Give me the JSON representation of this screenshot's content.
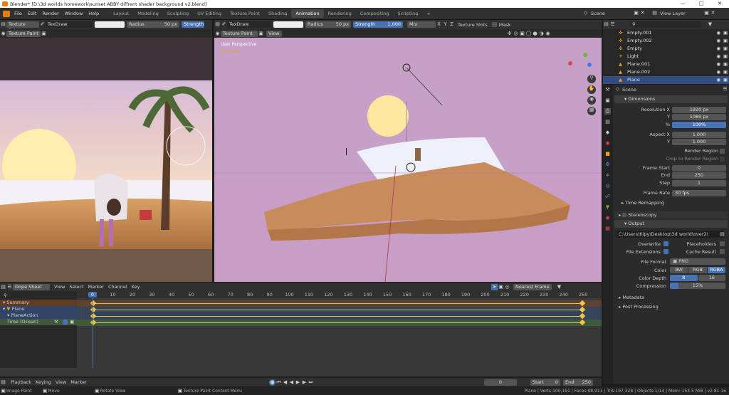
{
  "title": "Blender* [D:\\3d worlds homework\\sunset ABBY diffrent shader background v2.blend]",
  "menus": [
    "File",
    "Edit",
    "Render",
    "Window",
    "Help"
  ],
  "workspaces": [
    "Layout",
    "Modeling",
    "Sculpting",
    "UV Editing",
    "Texture Paint",
    "Shading",
    "Animation",
    "Rendering",
    "Compositing",
    "Scripting"
  ],
  "active_workspace": "Animation",
  "scene_name": "Scene",
  "view_layer": "View Layer",
  "left_view": {
    "mode": "Texture Paint",
    "brush": "TexDraw",
    "radius": "Radius",
    "radius_val": "50 px",
    "strength": "Strength"
  },
  "main_view": {
    "mode": "Texture Paint",
    "view": "View",
    "brush": "TexDraw",
    "radius": "Radius",
    "radius_val": "50 px",
    "strength": "Strength",
    "strength_val": "1.000",
    "blend": "Mix",
    "slots": "Texture Slots",
    "mask": "Mask",
    "persp": "User Perspective",
    "obj": "(0) Plane"
  },
  "outliner": [
    {
      "name": "Empty.001",
      "icon": "empty"
    },
    {
      "name": "Empty.002",
      "icon": "empty"
    },
    {
      "name": "Empty",
      "icon": "empty"
    },
    {
      "name": "Light",
      "icon": "light"
    },
    {
      "name": "Plane.001",
      "icon": "mesh"
    },
    {
      "name": "Plane.002",
      "icon": "mesh"
    },
    {
      "name": "Plane",
      "icon": "mesh"
    }
  ],
  "props": {
    "scene": "Scene",
    "dimensions": "Dimensions",
    "resx_l": "Resolution X",
    "resx": "1920 px",
    "resy_l": "Y",
    "resy": "1080 px",
    "pct_l": "%",
    "pct": "100%",
    "aspx_l": "Aspect X",
    "aspx": "1.000",
    "aspy_l": "Y",
    "aspy": "1.000",
    "render_region": "Render Region",
    "crop": "Crop to Render Region",
    "fstart_l": "Frame Start",
    "fstart": "0",
    "fend_l": "End",
    "fend": "250",
    "step_l": "Step",
    "step": "1",
    "frate_l": "Frame Rate",
    "frate": "30 fps",
    "time_remap": "Time Remapping",
    "stereo": "Stereoscopy",
    "output": "Output",
    "path": "C:\\Users\\Kipy\\Desktop\\3d world\\over2\\",
    "overwrite": "Overwrite",
    "placeholders": "Placeholders",
    "file_ext": "File Extensions",
    "cache": "Cache Result",
    "fformat_l": "File Format",
    "fformat": "PNG",
    "color_l": "Color",
    "bw": "BW",
    "rgb": "RGB",
    "rgba": "RGBA",
    "depth_l": "Color Depth",
    "d8": "8",
    "d16": "16",
    "comp_l": "Compression",
    "comp": "15%",
    "metadata": "Metadata",
    "post": "Post Processing"
  },
  "dope": {
    "mode": "Dope Sheet",
    "menus": [
      "View",
      "Select",
      "Marker",
      "Channel",
      "Key"
    ],
    "snap": "Nearest Frame",
    "ticks": [
      "0",
      "10",
      "20",
      "30",
      "40",
      "50",
      "60",
      "70",
      "80",
      "90",
      "100",
      "110",
      "120",
      "130",
      "140",
      "150",
      "160",
      "170",
      "180",
      "190",
      "200",
      "210",
      "220",
      "230",
      "240",
      "250"
    ],
    "current": "0",
    "channels": [
      "Summary",
      "Plane",
      "PlaneAction",
      "Time (Ocean)"
    ]
  },
  "timeline": {
    "menus": [
      "Playback",
      "Keying",
      "View",
      "Marker"
    ],
    "frame": "0",
    "start_l": "Start",
    "start": "0",
    "end_l": "End",
    "end": "250"
  },
  "status": {
    "left": "Image Paint",
    "move": "Move",
    "rotate": "Rotate View",
    "ctx": "Texture Paint Context Menu",
    "info": "Plane | Verts:100,191 | Faces:98,911 | Tris:197,328 | Objects:1/14 | Mem: 154.5 MiB | v2.81.16"
  }
}
